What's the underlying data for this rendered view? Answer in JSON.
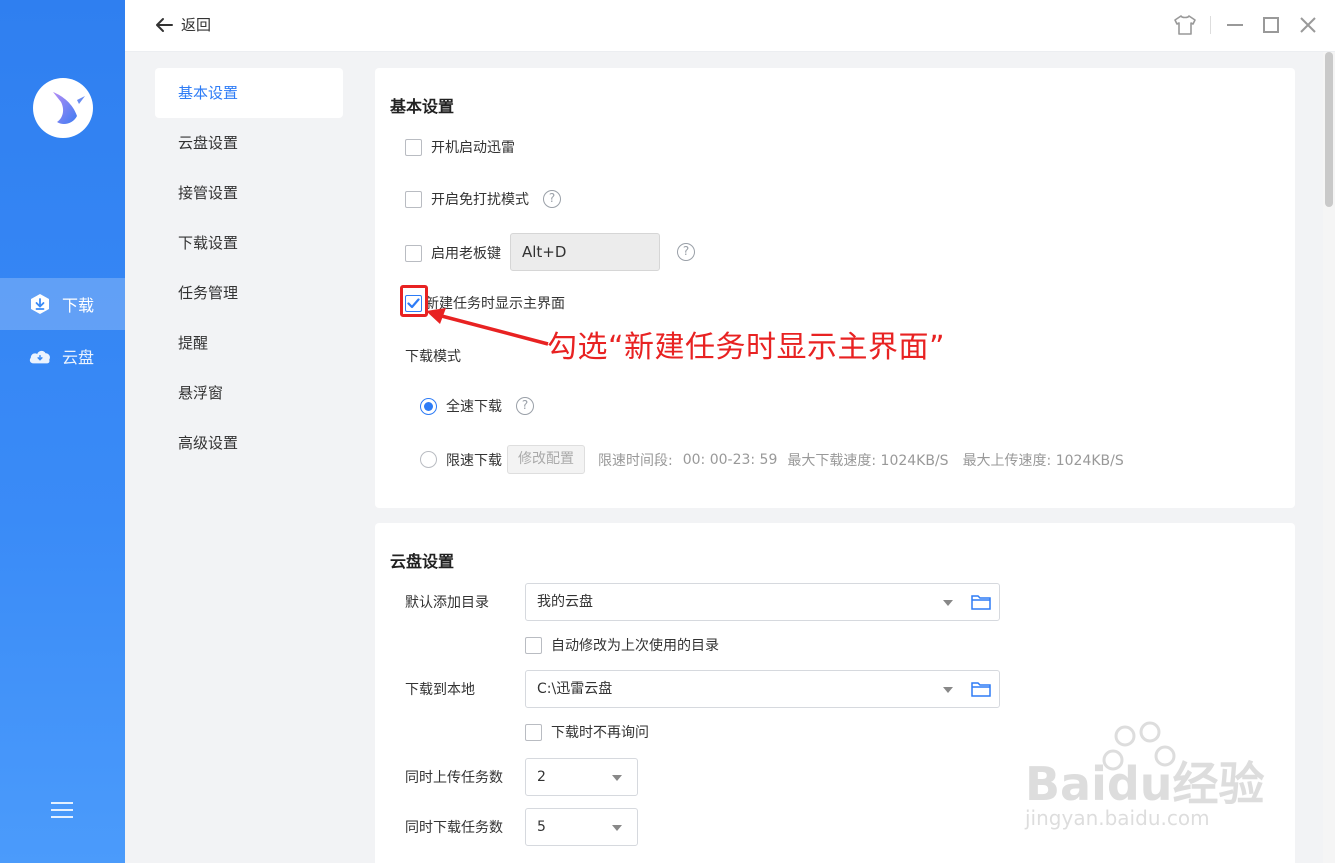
{
  "topbar": {
    "back_label": "返回"
  },
  "sidebar": {
    "items": [
      {
        "label": "下载",
        "icon": "download-shield-icon",
        "active": true
      },
      {
        "label": "云盘",
        "icon": "cloud-icon",
        "active": false
      }
    ]
  },
  "submenu": {
    "items": [
      {
        "label": "基本设置",
        "active": true
      },
      {
        "label": "云盘设置",
        "active": false
      },
      {
        "label": "接管设置",
        "active": false
      },
      {
        "label": "下载设置",
        "active": false
      },
      {
        "label": "任务管理",
        "active": false
      },
      {
        "label": "提醒",
        "active": false
      },
      {
        "label": "悬浮窗",
        "active": false
      },
      {
        "label": "高级设置",
        "active": false
      }
    ]
  },
  "basic": {
    "title": "基本设置",
    "autostart": {
      "label": "开机启动迅雷",
      "checked": false
    },
    "dnd": {
      "label": "开启免打扰模式",
      "checked": false
    },
    "bosskey": {
      "label": "启用老板键",
      "checked": false,
      "value": "Alt+D"
    },
    "show_main": {
      "label": "新建任务时显示主界面",
      "checked": true
    },
    "mode_title": "下载模式",
    "full_speed": {
      "label": "全速下载",
      "selected": true
    },
    "limited": {
      "label": "限速下载",
      "selected": false,
      "button": "修改配置",
      "period_label": "限速时间段:",
      "period_value": "00: 00-23: 59",
      "max_down": "最大下载速度: 1024KB/S",
      "max_up": "最大上传速度: 1024KB/S"
    }
  },
  "cloud": {
    "title": "云盘设置",
    "default_dir_label": "默认添加目录",
    "default_dir_value": "我的云盘",
    "auto_modify": {
      "label": "自动修改为上次使用的目录",
      "checked": false
    },
    "local_label": "下载到本地",
    "local_value": "C:\\迅雷云盘",
    "no_ask": {
      "label": "下载时不再询问",
      "checked": false
    },
    "upload_tasks_label": "同时上传任务数",
    "upload_tasks_value": "2",
    "download_tasks_label": "同时下载任务数",
    "download_tasks_value": "5"
  },
  "annotation": {
    "text": "勾选“新建任务时显示主界面”",
    "color": "#e82222"
  },
  "watermark": {
    "brand": "Baidu经验",
    "url": "jingyan.baidu.com"
  },
  "colors": {
    "accent": "#2e7cf6",
    "sidebar": "#3a8bf7"
  }
}
